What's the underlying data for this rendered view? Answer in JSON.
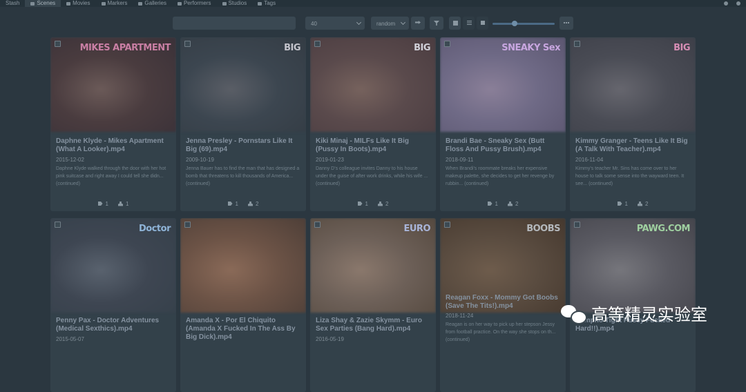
{
  "nav": {
    "items": [
      {
        "label": "Stash",
        "icon": "stash-logo"
      },
      {
        "label": "Scenes",
        "icon": "play-circle-icon",
        "active": true
      },
      {
        "label": "Movies",
        "icon": "film-icon"
      },
      {
        "label": "Markers",
        "icon": "map-marker-icon"
      },
      {
        "label": "Galleries",
        "icon": "image-icon"
      },
      {
        "label": "Performers",
        "icon": "user-icon"
      },
      {
        "label": "Studios",
        "icon": "video-icon"
      },
      {
        "label": "Tags",
        "icon": "tag-icon"
      }
    ],
    "right_icons": [
      "gear-icon",
      "sign-out-icon"
    ]
  },
  "toolbar": {
    "search_placeholder": "",
    "per_page": "40",
    "sort_by": "random",
    "zoom_level_fraction": 0.35,
    "icons": [
      "shuffle-icon",
      "filter-icon",
      "grid-view-icon",
      "list-view-icon",
      "wall-view-icon",
      "more-options-icon"
    ]
  },
  "scenes": [
    {
      "title": "Daphne Klyde - Mikes Apartment (What A Looker).mp4",
      "date": "2015-12-02",
      "description": "Daphne Klyde walked through the door with her hot pink suitcase and right away I could tell she didn... (continued)",
      "tags": "1",
      "performers": "1",
      "logo": "MIKES APARTMENT",
      "logo_color": "#c97fa4",
      "thumb_colors": [
        "#4a3c3f",
        "#6b5a58",
        "#3a3138"
      ]
    },
    {
      "title": "Jenna Presley - Pornstars Like It Big (69).mp4",
      "date": "2009-10-19",
      "description": "Jenna Bauer has to find the man that has designed a bomb that threatens to kill thousands of America... (continued)",
      "tags": "1",
      "performers": "2",
      "logo": "BIG",
      "logo_color": "#c4c4cc",
      "thumb_colors": [
        "#3c4650",
        "#5a5e66",
        "#343c44"
      ]
    },
    {
      "title": "Kiki Minaj - MILFs Like It Big (Pussy In Boots).mp4",
      "date": "2019-01-23",
      "description": "Danny D's colleague invites Danny to his house under the guise of after work drinks, while his wife ... (continued)",
      "tags": "1",
      "performers": "2",
      "logo": "BIG",
      "logo_color": "#d0d0d8",
      "thumb_colors": [
        "#5a4a4c",
        "#76625d",
        "#4a3c40"
      ]
    },
    {
      "title": "Brandi Bae - Sneaky Sex (Butt Floss And Pussy Brush).mp4",
      "date": "2018-09-11",
      "description": "When Brandi's roommate breaks her expensive makeup palette, she decides to get her revenge by rubbin... (continued)",
      "tags": "1",
      "performers": "2",
      "logo": "SNEAKY Sex",
      "logo_color": "#c8a6e0",
      "thumb_colors": [
        "#6f6a86",
        "#8a7f98",
        "#5b5670"
      ]
    },
    {
      "title": "Kimmy Granger - Teens Like It Big (A Talk With Teacher).mp4",
      "date": "2016-11-04",
      "description": "Kimmy's teacher Mr. Sins has come over to her house to talk some sense into the wayward teen. It see... (continued)",
      "tags": "1",
      "performers": "2",
      "logo": "BIG",
      "logo_color": "#d68db4",
      "thumb_colors": [
        "#4a4c55",
        "#66666e",
        "#3d3f48"
      ]
    },
    {
      "title": "Penny Pax - Doctor Adventures (Medical Sexthics).mp4",
      "date": "2015-05-07",
      "description": "",
      "tags": "",
      "performers": "",
      "logo": "Doctor",
      "logo_color": "#8fb4d8",
      "thumb_colors": [
        "#3e4652",
        "#59626e",
        "#35404a"
      ]
    },
    {
      "title": "Amanda X - Por El Chiquito (Amanda X Fucked In The Ass By Big Dick).mp4",
      "date": "",
      "description": "",
      "tags": "",
      "performers": "",
      "logo": "",
      "logo_color": "#555f68",
      "thumb_colors": [
        "#6c5346",
        "#8a6a58",
        "#4e3f38"
      ]
    },
    {
      "title": "Liza Shay & Zazie Skymm - Euro Sex Parties (Bang Hard).mp4",
      "date": "2016-05-19",
      "description": "",
      "tags": "",
      "performers": "",
      "logo": "EURO",
      "logo_color": "#a8b4d8",
      "thumb_colors": [
        "#6d6058",
        "#8a786c",
        "#55493f"
      ]
    },
    {
      "title": "Reagan Foxx - Mommy Got Boobs (Save The Tits!).mp4",
      "date": "2018-11-24",
      "description": "Reagan is on her way to pick up her stepson Jessy from football practice. On the way she stops on th... (continued)",
      "tags": "",
      "performers": "",
      "logo": "BOOBS",
      "logo_color": "#b4b8bc",
      "thumb_colors": [
        "#5a4c40",
        "#6e5c4c",
        "#45382e"
      ]
    },
    {
      "title": "Nympho Tight Pussy Fucked Hard!!).mp4",
      "date": "",
      "description": "",
      "tags": "",
      "performers": "",
      "logo": "PAWG.COM",
      "logo_color": "#9fd0a0",
      "thumb_colors": [
        "#5a5a62",
        "#76767c",
        "#45454c"
      ]
    }
  ],
  "watermark": {
    "text": "高等精灵实验室",
    "icon": "wechat-icon"
  }
}
